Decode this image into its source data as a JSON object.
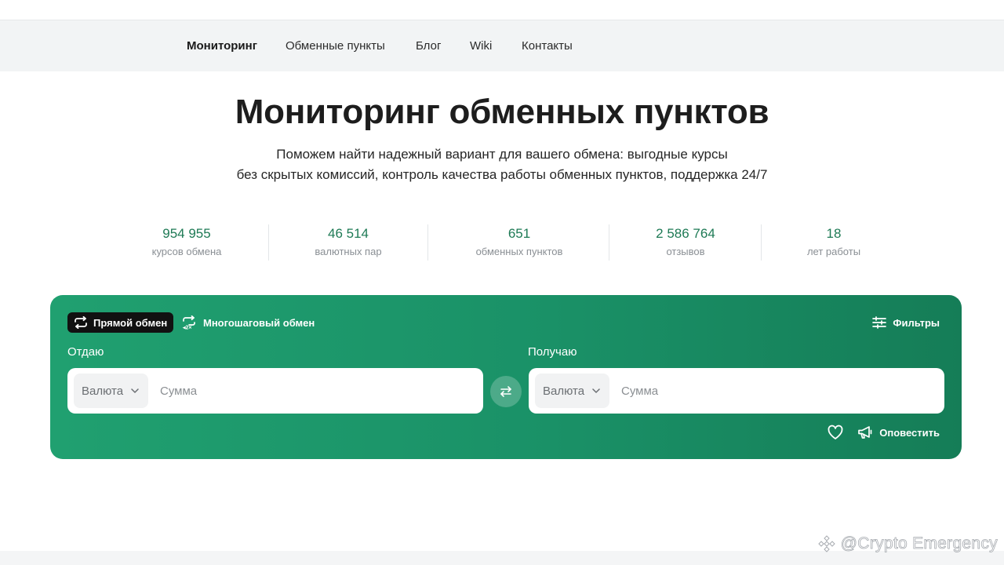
{
  "nav": {
    "items": [
      {
        "label": "Мониторинг",
        "active": true
      },
      {
        "label": "Обменные пункты",
        "active": false
      },
      {
        "label": "Блог",
        "active": false
      },
      {
        "label": "Wiki",
        "active": false
      },
      {
        "label": "Контакты",
        "active": false
      }
    ]
  },
  "hero": {
    "title": "Мониторинг обменных пунктов",
    "subtitle_line1": "Поможем найти надежный вариант для вашего обмена: выгодные курсы",
    "subtitle_line2": "без скрытых комиссий, контроль качества работы обменных пунктов, поддержка 24/7"
  },
  "stats": [
    {
      "value": "954 955",
      "label": "курсов обмена"
    },
    {
      "value": "46 514",
      "label": "валютных пар"
    },
    {
      "value": "651",
      "label": "обменных пунктов"
    },
    {
      "value": "2 586 764",
      "label": "отзывов"
    },
    {
      "value": "18",
      "label": "лет работы"
    }
  ],
  "exchange": {
    "tab_direct": "Прямой обмен",
    "tab_multistep": "Многошаговый обмен",
    "filters_label": "Фильтры",
    "give_label": "Отдаю",
    "receive_label": "Получаю",
    "give_currency": "Валюта",
    "receive_currency": "Валюта",
    "give_amount_placeholder": "Сумма",
    "receive_amount_placeholder": "Сумма",
    "notify_label": "Оповестить",
    "icons": {
      "direct": "swap-arrows-icon",
      "multistep": "multistep-swap-icon",
      "filters": "sliders-icon",
      "swap": "swap-horizontal-icon",
      "favorite": "heart-icon",
      "notify": "megaphone-icon"
    }
  },
  "colors": {
    "accent_green": "#1a9167",
    "stat_value": "#1e7a55"
  },
  "watermark": "@Crypto Emergency"
}
